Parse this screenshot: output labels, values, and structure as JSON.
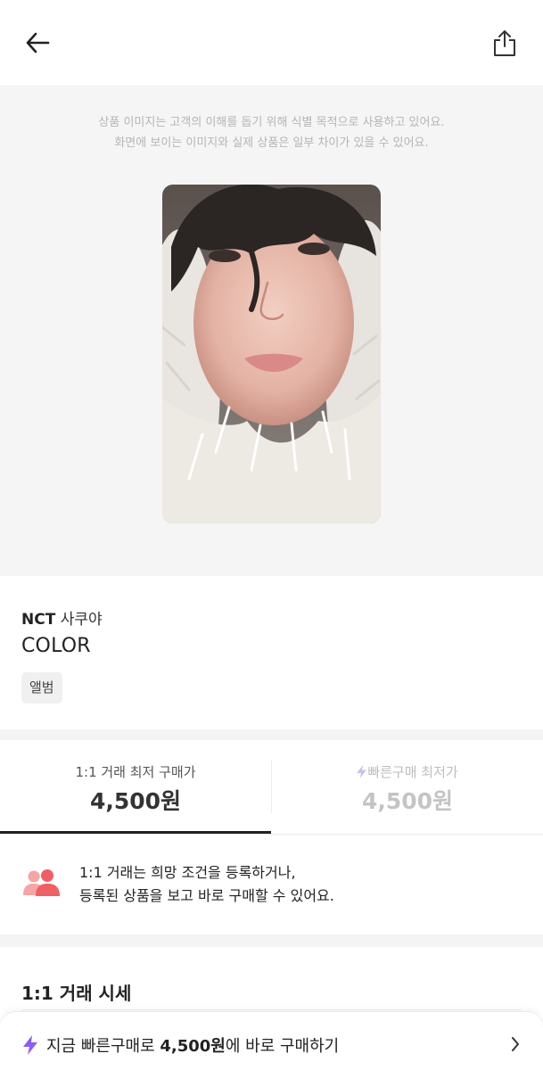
{
  "disclaimer": {
    "line1": "상품 이미지는 고객의 이해를 돕기 위해 식별 목적으로 사용하고 있어요.",
    "line2": "화면에 보이는 이미지와 실제 상품은 일부 차이가 있을 수 있어요."
  },
  "product": {
    "group": "NCT",
    "member": "사쿠야",
    "album": "COLOR",
    "tag": "앨범"
  },
  "tabs": {
    "left_label": "1:1 거래 최저 구매가",
    "left_price": "4,500원",
    "right_label": "빠른구매 최저가",
    "right_price": "4,500원"
  },
  "notice": {
    "line1": "1:1 거래는 희망 조건을 등록하거나,",
    "line2": "등록된 상품을 보고 바로 구매할 수 있어요."
  },
  "market": {
    "title": "1:1 거래 시세"
  },
  "quickbuy": {
    "prefix": "지금 빠른구매로 ",
    "price": "4,500원",
    "suffix": "에 바로 구매하기"
  },
  "icons": {
    "back": "arrow-left-icon",
    "share": "share-icon",
    "bolt": "lightning-bolt-icon",
    "users": "users-icon",
    "chevron": "chevron-right-icon"
  },
  "colors": {
    "accent_purple": "#8b5cf6",
    "users_red": "#f0646b",
    "text_main": "#222222",
    "muted": "#b5b5b5"
  }
}
